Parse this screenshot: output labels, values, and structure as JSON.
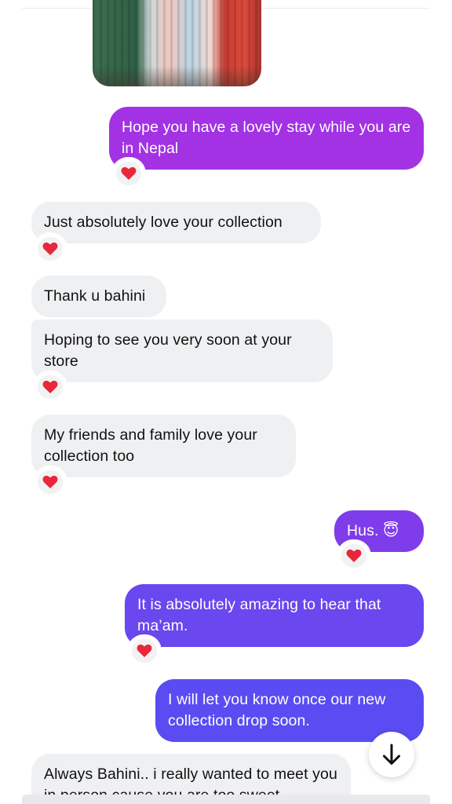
{
  "messages": {
    "m1": "Hope you have a lovely stay while you are in Nepal",
    "m2": "Just absolutely love your collection",
    "m3": "Thank u bahini",
    "m4": "Hoping to see you very soon at your store",
    "m5": "My friends and family love your collection too",
    "m6": "Hus. 😇",
    "m7": "It is absolutely amazing to hear that ma’am.",
    "m8": "I will let you know once our new collection drop soon.",
    "m9": "Always Bahini.. i really wanted to meet you in person cause you are too sweet"
  },
  "reaction": "heart-icon",
  "colors": {
    "incoming": "#eff0f2",
    "outgoing_top": "#a232e3",
    "outgoing_bottom": "#5a4cf2",
    "heart": "#e8273a"
  }
}
